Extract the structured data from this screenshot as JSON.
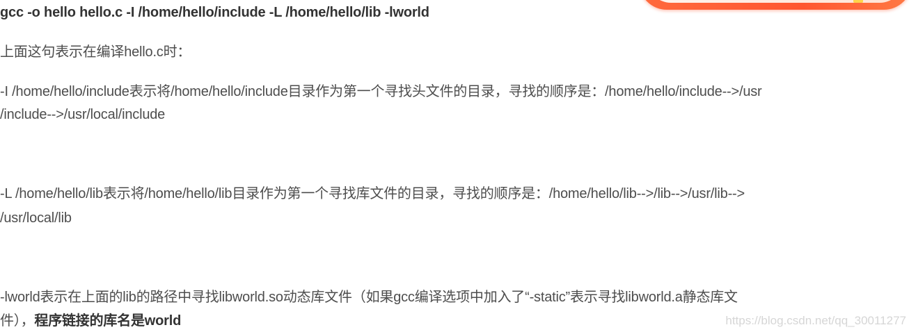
{
  "command": "gcc -o hello hello.c -I /home/hello/include -L /home/hello/lib -lworld",
  "intro": "上面这句表示在编译hello.c时：",
  "include_line1": "-I /home/hello/include表示将/home/hello/include目录作为第一个寻找头文件的目录，寻找的顺序是：/home/hello/include-->/usr",
  "include_line2": "/include-->/usr/local/include",
  "lib_line1": "-L /home/hello/lib表示将/home/hello/lib目录作为第一个寻找库文件的目录，寻找的顺序是：/home/hello/lib-->/lib-->/usr/lib-->",
  "lib_line2": "/usr/local/lib",
  "lworld_line1": " -lworld表示在上面的lib的路径中寻找libworld.so动态库文件（如果gcc编译选项中加入了“-static”表示寻找libworld.a静态库文",
  "lworld_line2_plain": "件），",
  "lworld_line2_bold": "程序链接的库名是world",
  "watermark": "https://blog.csdn.net/qq_30011277"
}
